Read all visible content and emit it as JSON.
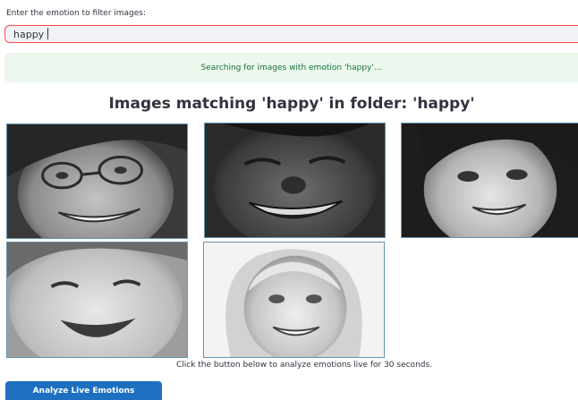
{
  "filter": {
    "label": "Enter the emotion to filter images:",
    "value": "happy"
  },
  "status": {
    "message": "Searching for images with emotion 'happy'..."
  },
  "results": {
    "title": "Images matching 'happy' in folder: 'happy'",
    "images": [
      {
        "id": "img-1",
        "alt": "smiling woman with glasses"
      },
      {
        "id": "img-2",
        "alt": "laughing man"
      },
      {
        "id": "img-3",
        "alt": "smiling young woman"
      },
      {
        "id": "img-4",
        "alt": "laughing baby"
      },
      {
        "id": "img-5",
        "alt": "smiling blonde woman"
      }
    ]
  },
  "live": {
    "caption": "Click the button below to analyze emotions live for 30 seconds.",
    "button_label": "Analyze Live Emotions"
  },
  "colors": {
    "accent": "#ff4b4b",
    "button": "#1e6fc0",
    "status_bg": "#ecf7ee",
    "status_text": "#177233",
    "thumb_border": "#5f95b4"
  }
}
